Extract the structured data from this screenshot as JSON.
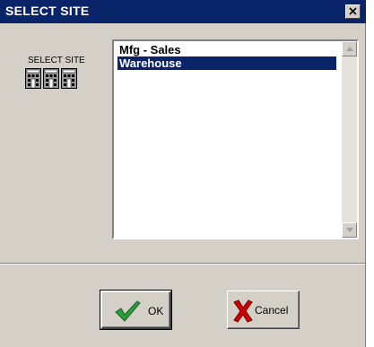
{
  "window": {
    "title": "SELECT SITE",
    "close_icon": "close-icon"
  },
  "side_label": {
    "caption": "SELECT SITE",
    "icon": "buildings-icon"
  },
  "site_list": {
    "items": [
      {
        "label": "Mfg - Sales",
        "selected": false
      },
      {
        "label": "Warehouse",
        "selected": true
      }
    ],
    "scrollbar": {
      "up_icon": "scroll-up-arrow-icon",
      "down_icon": "scroll-down-arrow-icon"
    }
  },
  "buttons": {
    "ok_label": "OK",
    "ok_icon": "checkmark-icon",
    "cancel_label": "Cancel",
    "cancel_icon": "red-x-icon"
  },
  "colors": {
    "titlebar": "#0a246a",
    "selection": "#0a246a",
    "face": "#d4d0c8",
    "ok_check": "#2a9d3a",
    "cancel_x": "#cc0000"
  }
}
